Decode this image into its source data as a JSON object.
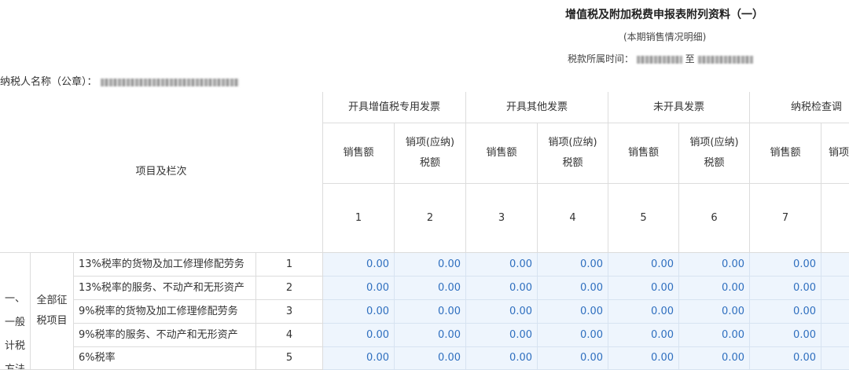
{
  "header": {
    "title": "增值税及附加税费申报表附列资料（一）",
    "subtitle": "(本期销售情况明细)",
    "period_label": "税款所属时间：",
    "period_sep": "至",
    "taxpayer_label": "纳税人名称（公章）："
  },
  "table": {
    "item_header": "项目及栏次",
    "groups": [
      "开具增值税专用发票",
      "开具其他发票",
      "未开具发票",
      "纳税检查调"
    ],
    "sub_sales": "销售额",
    "sub_tax": "销项(应纳)税额",
    "sub_partial": "销项",
    "col_numbers": [
      "1",
      "2",
      "3",
      "4",
      "5",
      "6",
      "7"
    ],
    "category": "一、一般计税方法",
    "subcategory": "全部征税项目",
    "rows": [
      {
        "label": "13%税率的货物及加工修理修配劳务",
        "line": "1",
        "values": [
          "0.00",
          "0.00",
          "0.00",
          "0.00",
          "0.00",
          "0.00",
          "0.00"
        ]
      },
      {
        "label": "13%税率的服务、不动产和无形资产",
        "line": "2",
        "values": [
          "0.00",
          "0.00",
          "0.00",
          "0.00",
          "0.00",
          "0.00",
          "0.00"
        ]
      },
      {
        "label": "9%税率的货物及加工修理修配劳务",
        "line": "3",
        "values": [
          "0.00",
          "0.00",
          "0.00",
          "0.00",
          "0.00",
          "0.00",
          "0.00"
        ]
      },
      {
        "label": "9%税率的服务、不动产和无形资产",
        "line": "4",
        "values": [
          "0.00",
          "0.00",
          "0.00",
          "0.00",
          "0.00",
          "0.00",
          "0.00"
        ]
      },
      {
        "label": "6%税率",
        "line": "5",
        "values": [
          "0.00",
          "0.00",
          "0.00",
          "0.00",
          "0.00",
          "0.00",
          "0.00"
        ]
      }
    ]
  }
}
